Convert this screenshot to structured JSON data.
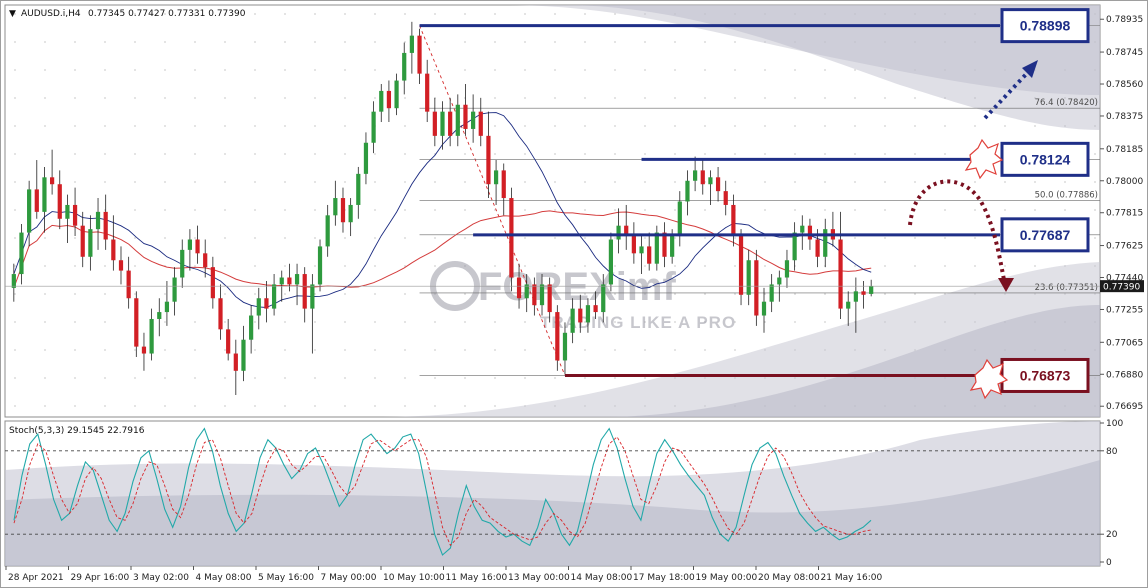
{
  "header": {
    "symbol_label": "AUDUSD.i,H4",
    "ohlc": "0.77345 0.77427 0.77331 0.77390"
  },
  "stoch_header": "Stoch(5,3,3) 29.1545 22.7916",
  "watermark": {
    "brand": "FOREXimf",
    "tagline": "TRADING LIKE A PRO"
  },
  "colors": {
    "bull": "#2e9a3e",
    "bear": "#d21f25",
    "ma_blue": "#1a2a80",
    "ma_red": "#d43c3c",
    "level_blue": "#1f2f88",
    "level_red": "#7a1020",
    "stoch_main": "#22a9a9",
    "stoch_signal": "#d9262b"
  },
  "price_axis": {
    "min": 0.7665,
    "max": 0.79,
    "ticks": [
      "0.78935",
      "0.78745",
      "0.78560",
      "0.78375",
      "0.78185",
      "0.78000",
      "0.77815",
      "0.77625",
      "0.77440",
      "0.77255",
      "0.77065",
      "0.76880",
      "0.76695"
    ],
    "current_price_label": "0.77390"
  },
  "stoch_axis": {
    "ticks": [
      "100",
      "80",
      "20",
      "0"
    ],
    "levels": [
      80,
      20
    ]
  },
  "time_axis": {
    "labels": [
      "28 Apr 2021",
      "29 Apr 16:00",
      "3 May 02:00",
      "4 May 08:00",
      "5 May 16:00",
      "7 May 00:00",
      "10 May 10:00",
      "11 May 16:00",
      "13 May 00:00",
      "14 May 08:00",
      "17 May 18:00",
      "19 May 00:00",
      "20 May 08:00",
      "21 May 16:00"
    ]
  },
  "annotations": {
    "level_boxes": [
      {
        "label": "0.78898",
        "price": 0.78898,
        "style": "blue"
      },
      {
        "label": "0.78124",
        "price": 0.78124,
        "style": "blue"
      },
      {
        "label": "0.77687",
        "price": 0.77687,
        "style": "blue"
      },
      {
        "label": "0.76873",
        "price": 0.76873,
        "style": "red"
      }
    ],
    "fibo_labels": [
      {
        "text": "76.4 (0.78420)",
        "price": 0.7842
      },
      {
        "text": "50.0 (0.77886)",
        "price": 0.77886
      },
      {
        "text": "23.6 (0.77351)",
        "price": 0.77351
      }
    ]
  },
  "chart_data": [
    {
      "type": "candlestick",
      "title": "",
      "xlabel": "",
      "ylabel": "",
      "ylim": [
        0.7665,
        0.79
      ],
      "candles": [
        {
          "o": 0.7738,
          "h": 0.7752,
          "l": 0.773,
          "c": 0.7746
        },
        {
          "o": 0.7746,
          "h": 0.7775,
          "l": 0.774,
          "c": 0.777
        },
        {
          "o": 0.777,
          "h": 0.78,
          "l": 0.7762,
          "c": 0.7795
        },
        {
          "o": 0.7795,
          "h": 0.7812,
          "l": 0.7778,
          "c": 0.7782
        },
        {
          "o": 0.7782,
          "h": 0.7808,
          "l": 0.777,
          "c": 0.7802
        },
        {
          "o": 0.7802,
          "h": 0.7818,
          "l": 0.7792,
          "c": 0.7798
        },
        {
          "o": 0.7798,
          "h": 0.7806,
          "l": 0.7772,
          "c": 0.7778
        },
        {
          "o": 0.7778,
          "h": 0.7792,
          "l": 0.7764,
          "c": 0.7786
        },
        {
          "o": 0.7786,
          "h": 0.7796,
          "l": 0.7768,
          "c": 0.7774
        },
        {
          "o": 0.7774,
          "h": 0.7782,
          "l": 0.775,
          "c": 0.7756
        },
        {
          "o": 0.7756,
          "h": 0.778,
          "l": 0.7748,
          "c": 0.7772
        },
        {
          "o": 0.7772,
          "h": 0.779,
          "l": 0.776,
          "c": 0.7782
        },
        {
          "o": 0.7782,
          "h": 0.7792,
          "l": 0.776,
          "c": 0.7766
        },
        {
          "o": 0.7766,
          "h": 0.778,
          "l": 0.7748,
          "c": 0.7754
        },
        {
          "o": 0.7754,
          "h": 0.7762,
          "l": 0.774,
          "c": 0.7748
        },
        {
          "o": 0.7748,
          "h": 0.7756,
          "l": 0.7726,
          "c": 0.7732
        },
        {
          "o": 0.7732,
          "h": 0.7736,
          "l": 0.7698,
          "c": 0.7704
        },
        {
          "o": 0.7704,
          "h": 0.7712,
          "l": 0.769,
          "c": 0.77
        },
        {
          "o": 0.77,
          "h": 0.7726,
          "l": 0.7696,
          "c": 0.772
        },
        {
          "o": 0.772,
          "h": 0.7732,
          "l": 0.771,
          "c": 0.7724
        },
        {
          "o": 0.7724,
          "h": 0.7742,
          "l": 0.7716,
          "c": 0.773
        },
        {
          "o": 0.773,
          "h": 0.775,
          "l": 0.7722,
          "c": 0.7744
        },
        {
          "o": 0.7744,
          "h": 0.7766,
          "l": 0.7738,
          "c": 0.776
        },
        {
          "o": 0.776,
          "h": 0.7772,
          "l": 0.7748,
          "c": 0.7766
        },
        {
          "o": 0.7766,
          "h": 0.7774,
          "l": 0.7752,
          "c": 0.7758
        },
        {
          "o": 0.7758,
          "h": 0.7766,
          "l": 0.7744,
          "c": 0.775
        },
        {
          "o": 0.775,
          "h": 0.7756,
          "l": 0.7726,
          "c": 0.7732
        },
        {
          "o": 0.7732,
          "h": 0.774,
          "l": 0.7708,
          "c": 0.7714
        },
        {
          "o": 0.7714,
          "h": 0.772,
          "l": 0.7696,
          "c": 0.77
        },
        {
          "o": 0.77,
          "h": 0.7708,
          "l": 0.7676,
          "c": 0.769
        },
        {
          "o": 0.769,
          "h": 0.7716,
          "l": 0.7684,
          "c": 0.7708
        },
        {
          "o": 0.7708,
          "h": 0.7728,
          "l": 0.77,
          "c": 0.7722
        },
        {
          "o": 0.7722,
          "h": 0.7738,
          "l": 0.7714,
          "c": 0.7732
        },
        {
          "o": 0.7732,
          "h": 0.7742,
          "l": 0.7718,
          "c": 0.7726
        },
        {
          "o": 0.7726,
          "h": 0.7746,
          "l": 0.7722,
          "c": 0.774
        },
        {
          "o": 0.774,
          "h": 0.7748,
          "l": 0.773,
          "c": 0.7744
        },
        {
          "o": 0.7744,
          "h": 0.7752,
          "l": 0.7736,
          "c": 0.774
        },
        {
          "o": 0.774,
          "h": 0.7752,
          "l": 0.7728,
          "c": 0.7746
        },
        {
          "o": 0.7746,
          "h": 0.775,
          "l": 0.7718,
          "c": 0.7726
        },
        {
          "o": 0.7726,
          "h": 0.7746,
          "l": 0.77,
          "c": 0.774
        },
        {
          "o": 0.774,
          "h": 0.7766,
          "l": 0.7736,
          "c": 0.7762
        },
        {
          "o": 0.7762,
          "h": 0.7786,
          "l": 0.7756,
          "c": 0.778
        },
        {
          "o": 0.778,
          "h": 0.78,
          "l": 0.7774,
          "c": 0.779
        },
        {
          "o": 0.779,
          "h": 0.7796,
          "l": 0.777,
          "c": 0.7776
        },
        {
          "o": 0.7776,
          "h": 0.779,
          "l": 0.7768,
          "c": 0.7786
        },
        {
          "o": 0.7786,
          "h": 0.7808,
          "l": 0.7778,
          "c": 0.7804
        },
        {
          "o": 0.7804,
          "h": 0.7828,
          "l": 0.7798,
          "c": 0.7822
        },
        {
          "o": 0.7822,
          "h": 0.7846,
          "l": 0.7816,
          "c": 0.784
        },
        {
          "o": 0.784,
          "h": 0.7856,
          "l": 0.7834,
          "c": 0.7852
        },
        {
          "o": 0.7852,
          "h": 0.7858,
          "l": 0.7834,
          "c": 0.7842
        },
        {
          "o": 0.7842,
          "h": 0.7862,
          "l": 0.7838,
          "c": 0.7858
        },
        {
          "o": 0.7858,
          "h": 0.788,
          "l": 0.785,
          "c": 0.7874
        },
        {
          "o": 0.7874,
          "h": 0.7892,
          "l": 0.7862,
          "c": 0.7884
        },
        {
          "o": 0.7884,
          "h": 0.7888,
          "l": 0.7856,
          "c": 0.7862
        },
        {
          "o": 0.7862,
          "h": 0.787,
          "l": 0.7834,
          "c": 0.784
        },
        {
          "o": 0.784,
          "h": 0.7848,
          "l": 0.782,
          "c": 0.7826
        },
        {
          "o": 0.7826,
          "h": 0.7846,
          "l": 0.7818,
          "c": 0.784
        },
        {
          "o": 0.784,
          "h": 0.7848,
          "l": 0.782,
          "c": 0.7826
        },
        {
          "o": 0.7826,
          "h": 0.785,
          "l": 0.782,
          "c": 0.7844
        },
        {
          "o": 0.7844,
          "h": 0.7856,
          "l": 0.7826,
          "c": 0.783
        },
        {
          "o": 0.783,
          "h": 0.785,
          "l": 0.7822,
          "c": 0.784
        },
        {
          "o": 0.784,
          "h": 0.7848,
          "l": 0.782,
          "c": 0.7826
        },
        {
          "o": 0.7826,
          "h": 0.784,
          "l": 0.779,
          "c": 0.7798
        },
        {
          "o": 0.7798,
          "h": 0.7812,
          "l": 0.7786,
          "c": 0.7806
        },
        {
          "o": 0.7806,
          "h": 0.781,
          "l": 0.778,
          "c": 0.779
        },
        {
          "o": 0.779,
          "h": 0.7796,
          "l": 0.7736,
          "c": 0.7744
        },
        {
          "o": 0.7744,
          "h": 0.7752,
          "l": 0.7726,
          "c": 0.7732
        },
        {
          "o": 0.7732,
          "h": 0.7746,
          "l": 0.7724,
          "c": 0.774
        },
        {
          "o": 0.774,
          "h": 0.7744,
          "l": 0.7722,
          "c": 0.7728
        },
        {
          "o": 0.7728,
          "h": 0.7746,
          "l": 0.7722,
          "c": 0.774
        },
        {
          "o": 0.774,
          "h": 0.7744,
          "l": 0.7718,
          "c": 0.7724
        },
        {
          "o": 0.7724,
          "h": 0.7728,
          "l": 0.769,
          "c": 0.7696
        },
        {
          "o": 0.7696,
          "h": 0.7718,
          "l": 0.7688,
          "c": 0.7712
        },
        {
          "o": 0.7712,
          "h": 0.7732,
          "l": 0.7706,
          "c": 0.7726
        },
        {
          "o": 0.7726,
          "h": 0.7734,
          "l": 0.7712,
          "c": 0.7718
        },
        {
          "o": 0.7718,
          "h": 0.7732,
          "l": 0.7712,
          "c": 0.7728
        },
        {
          "o": 0.7728,
          "h": 0.7736,
          "l": 0.772,
          "c": 0.7724
        },
        {
          "o": 0.7724,
          "h": 0.7746,
          "l": 0.7718,
          "c": 0.774
        },
        {
          "o": 0.774,
          "h": 0.777,
          "l": 0.7736,
          "c": 0.7766
        },
        {
          "o": 0.7766,
          "h": 0.7784,
          "l": 0.7758,
          "c": 0.7774
        },
        {
          "o": 0.7774,
          "h": 0.7786,
          "l": 0.776,
          "c": 0.7768
        },
        {
          "o": 0.7768,
          "h": 0.7776,
          "l": 0.7752,
          "c": 0.7758
        },
        {
          "o": 0.7758,
          "h": 0.7768,
          "l": 0.7746,
          "c": 0.7762
        },
        {
          "o": 0.7762,
          "h": 0.777,
          "l": 0.7748,
          "c": 0.7752
        },
        {
          "o": 0.7752,
          "h": 0.7774,
          "l": 0.7748,
          "c": 0.777
        },
        {
          "o": 0.777,
          "h": 0.7776,
          "l": 0.775,
          "c": 0.7756
        },
        {
          "o": 0.7756,
          "h": 0.7772,
          "l": 0.7752,
          "c": 0.7768
        },
        {
          "o": 0.7768,
          "h": 0.7794,
          "l": 0.7762,
          "c": 0.7788
        },
        {
          "o": 0.7788,
          "h": 0.7806,
          "l": 0.778,
          "c": 0.78
        },
        {
          "o": 0.78,
          "h": 0.7814,
          "l": 0.7794,
          "c": 0.7806
        },
        {
          "o": 0.7806,
          "h": 0.7812,
          "l": 0.7792,
          "c": 0.7798
        },
        {
          "o": 0.7798,
          "h": 0.7806,
          "l": 0.7786,
          "c": 0.7802
        },
        {
          "o": 0.7802,
          "h": 0.7808,
          "l": 0.7788,
          "c": 0.7794
        },
        {
          "o": 0.7794,
          "h": 0.78,
          "l": 0.778,
          "c": 0.7786
        },
        {
          "o": 0.7786,
          "h": 0.7792,
          "l": 0.7762,
          "c": 0.7768
        },
        {
          "o": 0.7768,
          "h": 0.7772,
          "l": 0.7728,
          "c": 0.7734
        },
        {
          "o": 0.7734,
          "h": 0.776,
          "l": 0.7728,
          "c": 0.7754
        },
        {
          "o": 0.7754,
          "h": 0.776,
          "l": 0.7716,
          "c": 0.7722
        },
        {
          "o": 0.7722,
          "h": 0.7738,
          "l": 0.7712,
          "c": 0.773
        },
        {
          "o": 0.773,
          "h": 0.7746,
          "l": 0.7724,
          "c": 0.774
        },
        {
          "o": 0.774,
          "h": 0.7748,
          "l": 0.773,
          "c": 0.7744
        },
        {
          "o": 0.7744,
          "h": 0.776,
          "l": 0.7738,
          "c": 0.7754
        },
        {
          "o": 0.7754,
          "h": 0.7776,
          "l": 0.7748,
          "c": 0.777
        },
        {
          "o": 0.777,
          "h": 0.778,
          "l": 0.776,
          "c": 0.7774
        },
        {
          "o": 0.7774,
          "h": 0.7778,
          "l": 0.776,
          "c": 0.7766
        },
        {
          "o": 0.7766,
          "h": 0.7772,
          "l": 0.775,
          "c": 0.7756
        },
        {
          "o": 0.7756,
          "h": 0.7778,
          "l": 0.775,
          "c": 0.7772
        },
        {
          "o": 0.7772,
          "h": 0.7782,
          "l": 0.7762,
          "c": 0.7766
        },
        {
          "o": 0.7766,
          "h": 0.7782,
          "l": 0.772,
          "c": 0.7726
        },
        {
          "o": 0.7726,
          "h": 0.7736,
          "l": 0.7716,
          "c": 0.773
        },
        {
          "o": 0.773,
          "h": 0.7744,
          "l": 0.7712,
          "c": 0.7736
        },
        {
          "o": 0.7736,
          "h": 0.7742,
          "l": 0.7726,
          "c": 0.7734
        },
        {
          "o": 0.77345,
          "h": 0.77427,
          "l": 0.77331,
          "c": 0.7739
        }
      ],
      "ma_series": [
        {
          "color": "blue",
          "values": [
            0.7752,
            0.7762,
            0.7776
          ],
          "note": "slow"
        }
      ]
    },
    {
      "type": "line",
      "title": "",
      "ylim": [
        0,
        100
      ],
      "series": [
        {
          "name": "main",
          "values": [
            30,
            62,
            85,
            92,
            70,
            45,
            30,
            35,
            55,
            72,
            66,
            48,
            30,
            22,
            35,
            58,
            75,
            80,
            60,
            38,
            25,
            40,
            68,
            88,
            96,
            80,
            55,
            35,
            22,
            28,
            50,
            75,
            88,
            82,
            70,
            60,
            66,
            78,
            82,
            70,
            55,
            40,
            48,
            70,
            88,
            92,
            85,
            78,
            82,
            90,
            92,
            78,
            50,
            20,
            5,
            10,
            35,
            55,
            40,
            30,
            28,
            22,
            18,
            20,
            15,
            12,
            25,
            45,
            35,
            20,
            12,
            22,
            45,
            70,
            88,
            96,
            82,
            60,
            40,
            30,
            55,
            78,
            88,
            80,
            70,
            62,
            55,
            48,
            32,
            20,
            15,
            25,
            48,
            70,
            82,
            86,
            78,
            62,
            48,
            35,
            28,
            22,
            25,
            20,
            16,
            18,
            22,
            25,
            30
          ]
        },
        {
          "name": "signal",
          "values": [
            28,
            45,
            70,
            85,
            80,
            62,
            45,
            35,
            42,
            60,
            68,
            60,
            45,
            32,
            30,
            42,
            60,
            72,
            70,
            55,
            38,
            32,
            48,
            70,
            86,
            88,
            75,
            55,
            35,
            28,
            35,
            55,
            72,
            82,
            80,
            70,
            65,
            70,
            76,
            76,
            66,
            55,
            48,
            55,
            70,
            85,
            88,
            84,
            80,
            84,
            88,
            88,
            75,
            50,
            25,
            12,
            18,
            35,
            45,
            40,
            32,
            28,
            24,
            20,
            18,
            16,
            18,
            28,
            35,
            30,
            22,
            18,
            28,
            48,
            68,
            85,
            90,
            80,
            62,
            45,
            42,
            55,
            72,
            82,
            80,
            72,
            64,
            56,
            46,
            34,
            24,
            20,
            28,
            45,
            62,
            76,
            82,
            76,
            64,
            50,
            40,
            32,
            26,
            24,
            22,
            20,
            20,
            22,
            23
          ]
        }
      ],
      "levels": [
        80,
        20
      ]
    }
  ]
}
